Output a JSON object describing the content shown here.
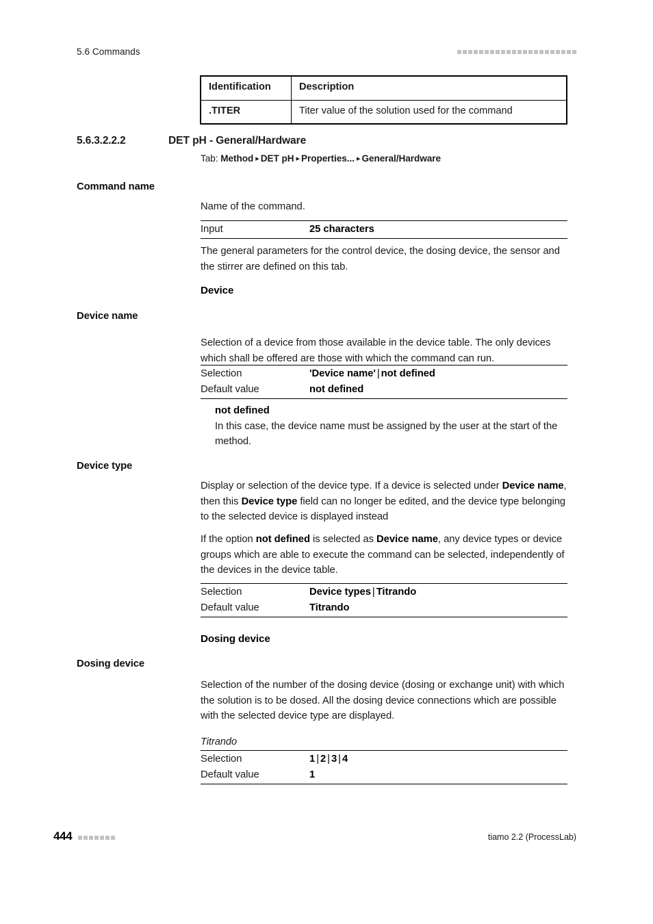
{
  "header": {
    "running_title": "5.6 Commands",
    "decoration_square_count": 22,
    "decoration_color": "#c2c2c2"
  },
  "id_table": {
    "columns": [
      "Identification",
      "Description"
    ],
    "rows": [
      {
        "identification": ".TITER",
        "description": "Titer value of the solution used for the command"
      }
    ]
  },
  "section": {
    "number": "5.6.3.2.2.2",
    "title": "DET pH - General/Hardware",
    "breadcrumb": {
      "lead": "Tab:",
      "separator": "▸",
      "items": [
        "Method",
        "DET pH",
        "Properties...",
        "General/Hardware"
      ]
    }
  },
  "blocks": {
    "command_name": {
      "margin_label": "Command name",
      "description": "Name of the command.",
      "spec": {
        "rows": [
          {
            "key": "Input",
            "value": "25 characters"
          }
        ]
      },
      "after_text": "The general parameters for the control device, the dosing device, the sensor and the stirrer are defined on this tab."
    },
    "device_group": {
      "heading": "Device"
    },
    "device_name": {
      "margin_label": "Device name",
      "description": "Selection of a device from those available in the device table. The only devices which shall be offered are those with which the command can run.",
      "spec": {
        "rows": [
          {
            "key": "Selection",
            "value_parts": [
              "'Device name'",
              "not defined"
            ]
          },
          {
            "key": "Default value",
            "value_parts": [
              "not defined"
            ]
          }
        ]
      },
      "note": {
        "heading": "not defined",
        "text": "In this case, the device name must be assigned by the user at the start of the method."
      }
    },
    "device_type": {
      "margin_label": "Device type",
      "paragraph_1_parts": [
        {
          "text": "Display or selection of the device type. If a device is selected under ",
          "bold": false
        },
        {
          "text": "Device name",
          "bold": true
        },
        {
          "text": ", then this ",
          "bold": false
        },
        {
          "text": "Device type",
          "bold": true
        },
        {
          "text": " field can no longer be edited, and the device type belonging to the selected device is displayed instead",
          "bold": false
        }
      ],
      "paragraph_2_parts": [
        {
          "text": "If the option ",
          "bold": false
        },
        {
          "text": "not defined",
          "bold": true
        },
        {
          "text": " is selected as ",
          "bold": false
        },
        {
          "text": "Device name",
          "bold": true
        },
        {
          "text": ", any device types or device groups which are able to execute the command can be selected, independently of the devices in the device table.",
          "bold": false
        }
      ],
      "spec": {
        "rows": [
          {
            "key": "Selection",
            "value_parts": [
              "Device types",
              "Titrando"
            ]
          },
          {
            "key": "Default value",
            "value_parts": [
              "Titrando"
            ]
          }
        ]
      }
    },
    "dosing_device_group": {
      "heading": "Dosing device"
    },
    "dosing_device": {
      "margin_label": "Dosing device",
      "description": "Selection of the number of the dosing device (dosing or exchange unit) with which the solution is to be dosed. All the dosing device connections which are possible with the selected device type are displayed.",
      "spec": {
        "caption": "Titrando",
        "rows": [
          {
            "key": "Selection",
            "value_parts": [
              "1",
              "2",
              "3",
              "4"
            ]
          },
          {
            "key": "Default value",
            "value_parts": [
              "1"
            ]
          }
        ]
      }
    }
  },
  "footer": {
    "page_number": "444",
    "decoration_square_count": 7,
    "right_text": "tiamo 2.2 (ProcessLab)"
  }
}
